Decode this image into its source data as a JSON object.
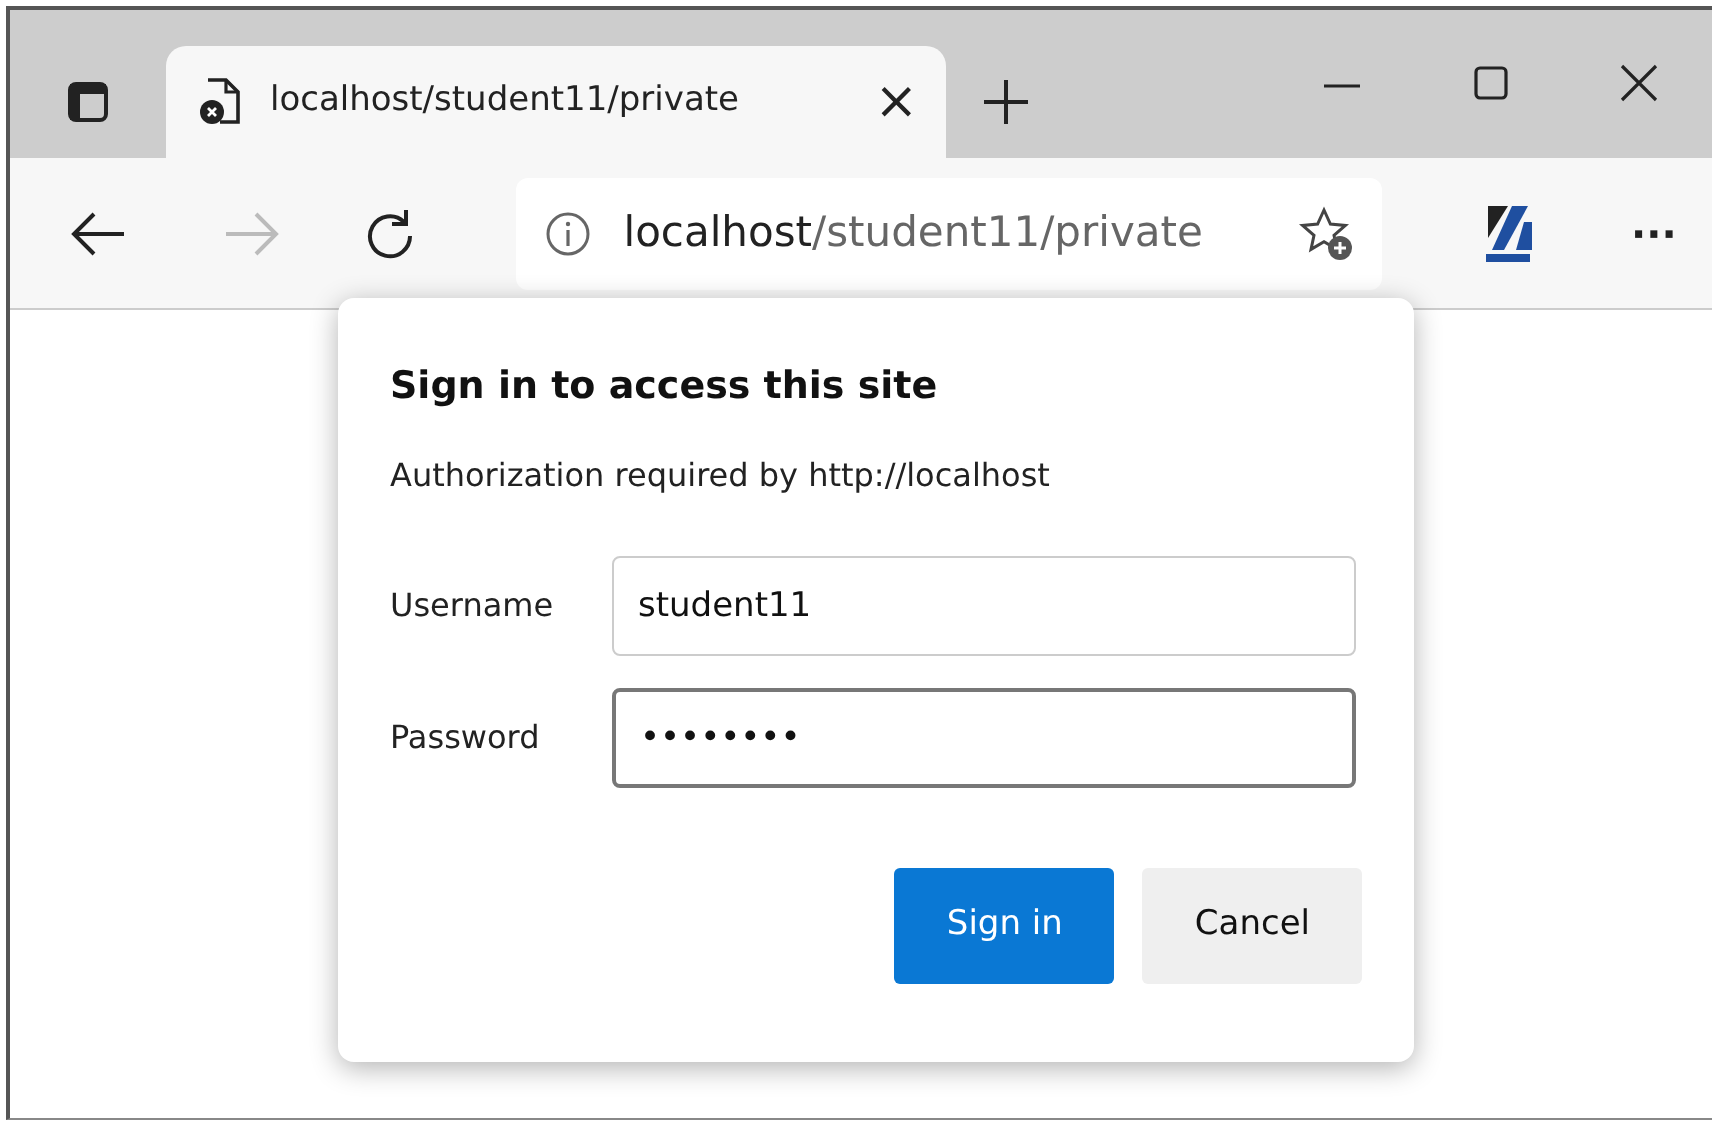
{
  "tabs": [
    {
      "title": "localhost/student11/private",
      "selected": true,
      "close": "×"
    }
  ],
  "toolbar": {
    "back_disabled": false,
    "forward_disabled": true,
    "address_host": "localhost",
    "address_path": "/student11/private",
    "more": "···"
  },
  "dialog": {
    "title": "Sign in to access this site",
    "message": "Authorization required by http://localhost",
    "fields": [
      {
        "label": "Username",
        "value": "student11",
        "focused": false
      },
      {
        "label": "Password",
        "value": "••••••••",
        "focused": true
      }
    ],
    "buttons": [
      {
        "label": "Sign in",
        "kind": "primary"
      },
      {
        "label": "Cancel",
        "kind": "secondary"
      }
    ]
  }
}
